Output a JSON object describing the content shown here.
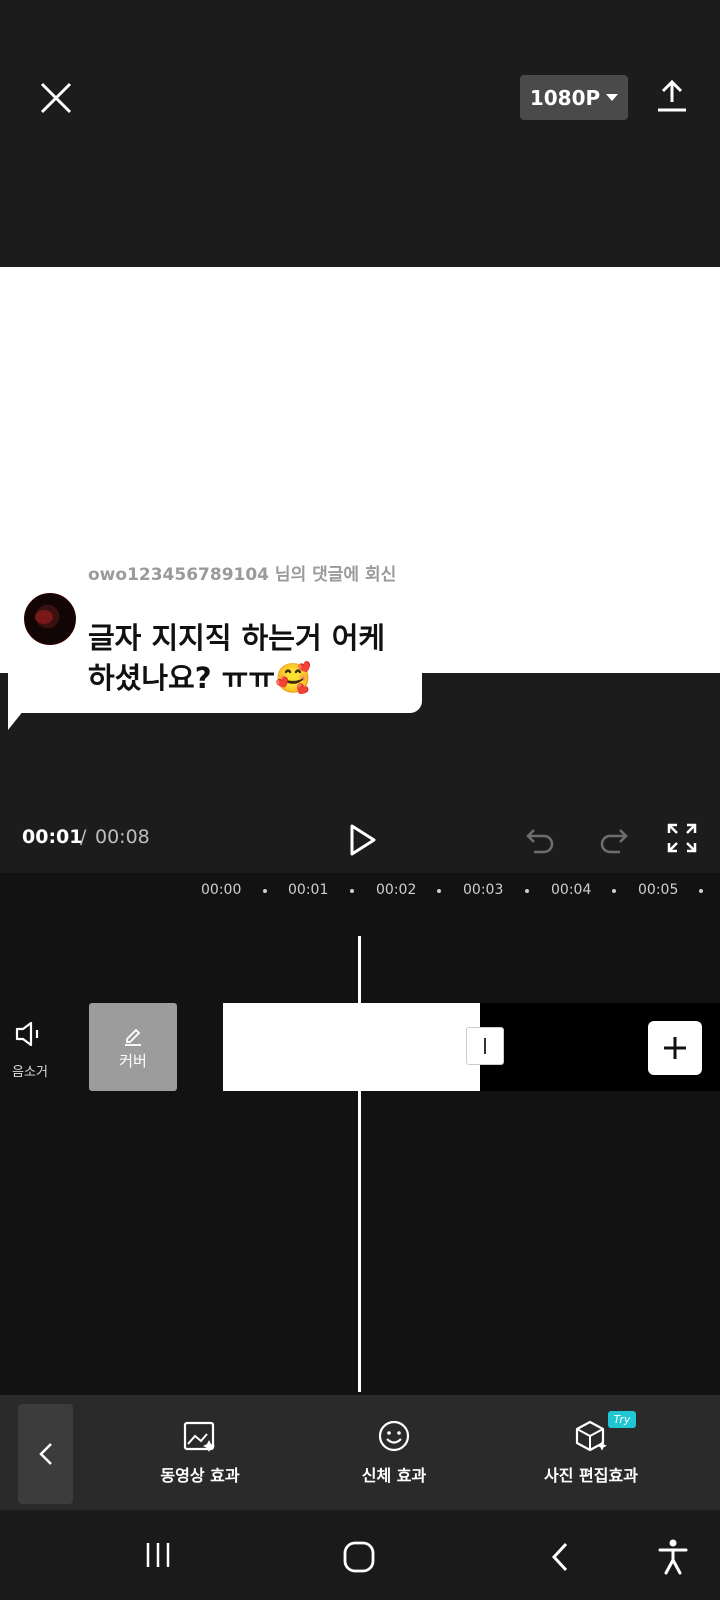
{
  "header": {
    "resolution_label": "1080P"
  },
  "comment_bubble": {
    "reply_to": "owo123456789104 님의 댓글에 회신",
    "comment": "글자 지지직 하는거 어케 하셨나요? ㅠㅠ🥰"
  },
  "playback": {
    "current_time": "00:01",
    "separator": "/",
    "total_time": "00:08"
  },
  "timeline": {
    "ruler": [
      "00:00",
      "00:01",
      "00:02",
      "00:03",
      "00:04",
      "00:05"
    ],
    "mute_label": "음소거",
    "cover_label": "커버"
  },
  "toolbar": {
    "tools": [
      {
        "label": "동영상 효과",
        "icon": "video-effect-icon"
      },
      {
        "label": "신체 효과",
        "icon": "smiley-icon"
      },
      {
        "label": "사진 편집효과",
        "icon": "photo-effect-icon"
      }
    ],
    "try_badge": "Try"
  }
}
